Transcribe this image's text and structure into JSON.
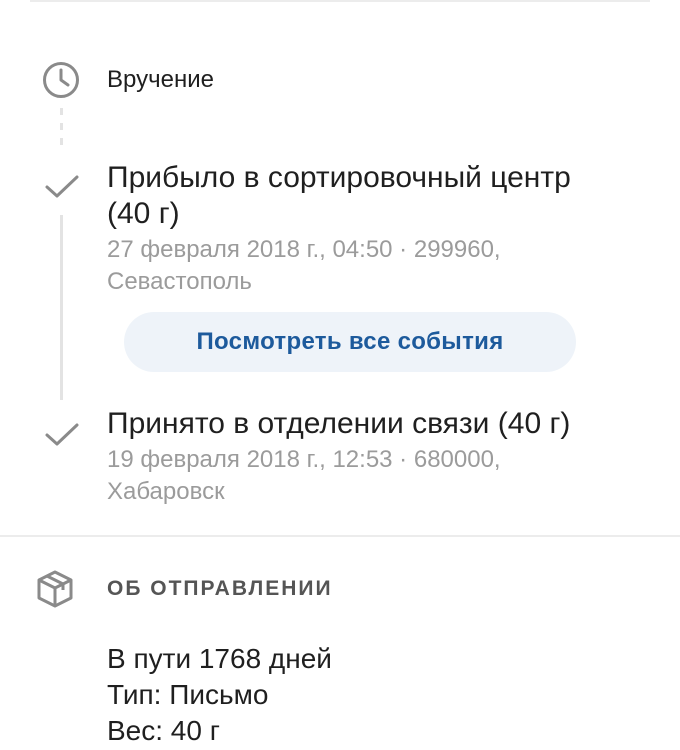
{
  "timeline": {
    "delivery_label": "Вручение",
    "events": [
      {
        "title_line1": "Прибыло в сортировочный центр",
        "title_line2": "(40 г)",
        "meta_line1": "27 февраля 2018 г., 04:50 · 299960,",
        "meta_line2": "Севастополь"
      },
      {
        "title_line1": "Принято в отделении связи (40 г)",
        "meta_line1": "19 февраля 2018 г., 12:53 · 680000,",
        "meta_line2": "Хабаровск"
      }
    ],
    "all_events_button": "Посмотреть все события"
  },
  "shipment": {
    "header": "ОБ ОТПРАВЛЕНИИ",
    "in_transit": "В пути 1768 дней",
    "type": "Тип: Письмо",
    "weight": "Вес: 40 г"
  },
  "colors": {
    "accent": "#1d5a9c",
    "button_bg": "#eef3f9",
    "muted_text": "#9b9b9b",
    "icon_gray": "#8a8a8a",
    "divider": "#ececec"
  }
}
